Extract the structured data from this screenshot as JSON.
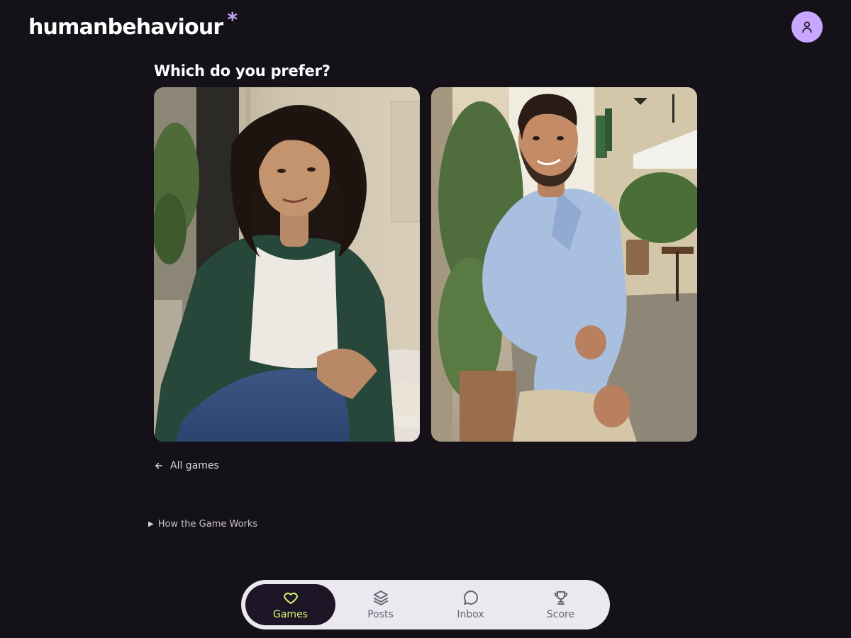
{
  "header": {
    "logo_text": "humanbehaviour",
    "logo_star": "*",
    "avatar_icon": "user-icon"
  },
  "game": {
    "question": "Which do you prefer?",
    "options": [
      {
        "name": "photo-option-left",
        "subject": "woman with curly hair at cafe"
      },
      {
        "name": "photo-option-right",
        "subject": "man in light blue shirt on street"
      }
    ]
  },
  "links": {
    "back_label": "All games",
    "how_label": "How the Game Works"
  },
  "nav": {
    "items": [
      {
        "label": "Games",
        "icon": "heart-icon",
        "active": true
      },
      {
        "label": "Posts",
        "icon": "layers-icon",
        "active": false
      },
      {
        "label": "Inbox",
        "icon": "chat-bubble-icon",
        "active": false
      },
      {
        "label": "Score",
        "icon": "trophy-icon",
        "active": false
      }
    ]
  },
  "colors": {
    "background": "#141118",
    "accent": "#c9a6ff",
    "active_label": "#d9f76b",
    "nav_bg": "#ece8f0"
  }
}
